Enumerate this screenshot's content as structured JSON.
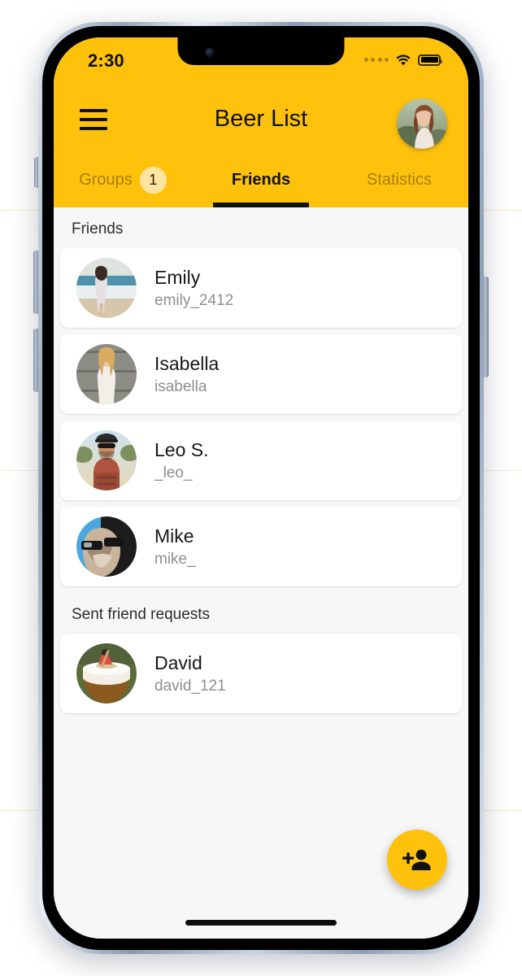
{
  "status_bar": {
    "time": "2:30",
    "signal_icon": "cellular-dots-icon",
    "wifi_icon": "wifi-icon",
    "battery_icon": "battery-full-icon"
  },
  "app_bar": {
    "menu_icon": "hamburger-menu-icon",
    "title": "Beer List",
    "avatar_icon": "user-avatar"
  },
  "tabs": [
    {
      "label": "Groups",
      "badge": "1",
      "active": false
    },
    {
      "label": "Friends",
      "badge": null,
      "active": true
    },
    {
      "label": "Statistics",
      "badge": null,
      "active": false
    }
  ],
  "sections": [
    {
      "header": "Friends",
      "items": [
        {
          "name": "Emily",
          "handle": "emily_2412",
          "avatar": "emily-avatar"
        },
        {
          "name": "Isabella",
          "handle": "isabella",
          "avatar": "isabella-avatar"
        },
        {
          "name": "Leo S.",
          "handle": "_leo_",
          "avatar": "leo-avatar"
        },
        {
          "name": "Mike",
          "handle": "mike_",
          "avatar": "mike-avatar"
        }
      ]
    },
    {
      "header": "Sent friend requests",
      "items": [
        {
          "name": "David",
          "handle": "david_121",
          "avatar": "david-avatar"
        }
      ]
    }
  ],
  "fab": {
    "icon": "person-add-icon",
    "label": "Add friend"
  },
  "colors": {
    "brand_yellow": "#FEC20D",
    "badge_yellow": "#FDE4A0",
    "page_background": "#F7F7F7",
    "card_background": "#FFFFFF",
    "primary_text": "#171717",
    "secondary_text": "#8E8E8E"
  }
}
